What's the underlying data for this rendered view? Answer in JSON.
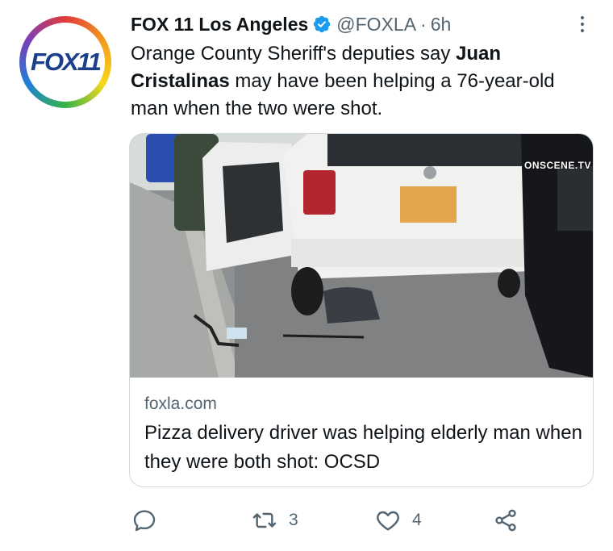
{
  "account": {
    "avatar_text": "FOX11",
    "display_name": "FOX 11 Los Angeles",
    "handle": "@FOXLA",
    "separator": "·",
    "time": "6h"
  },
  "tweet": {
    "text_before": "Orange County Sheriff's deputies say ",
    "text_bold": "Juan Cristalinas",
    "text_after": " may have been helping a 76-year-old man when the two were shot."
  },
  "card": {
    "watermark": "ONSCENE.TV",
    "domain": "foxla.com",
    "title": "Pizza delivery driver was helping elderly man when they were both shot: OCSD"
  },
  "actions": {
    "reply_count": "",
    "retweet_count": "3",
    "like_count": "4"
  },
  "icons": {
    "verified": "verified-badge-icon",
    "more": "more-vertical-icon",
    "reply": "reply-icon",
    "retweet": "retweet-icon",
    "like": "heart-icon",
    "share": "share-icon"
  },
  "colors": {
    "verified_blue": "#1d9bf0",
    "secondary_text": "#536471",
    "primary_text": "#0f1419"
  }
}
